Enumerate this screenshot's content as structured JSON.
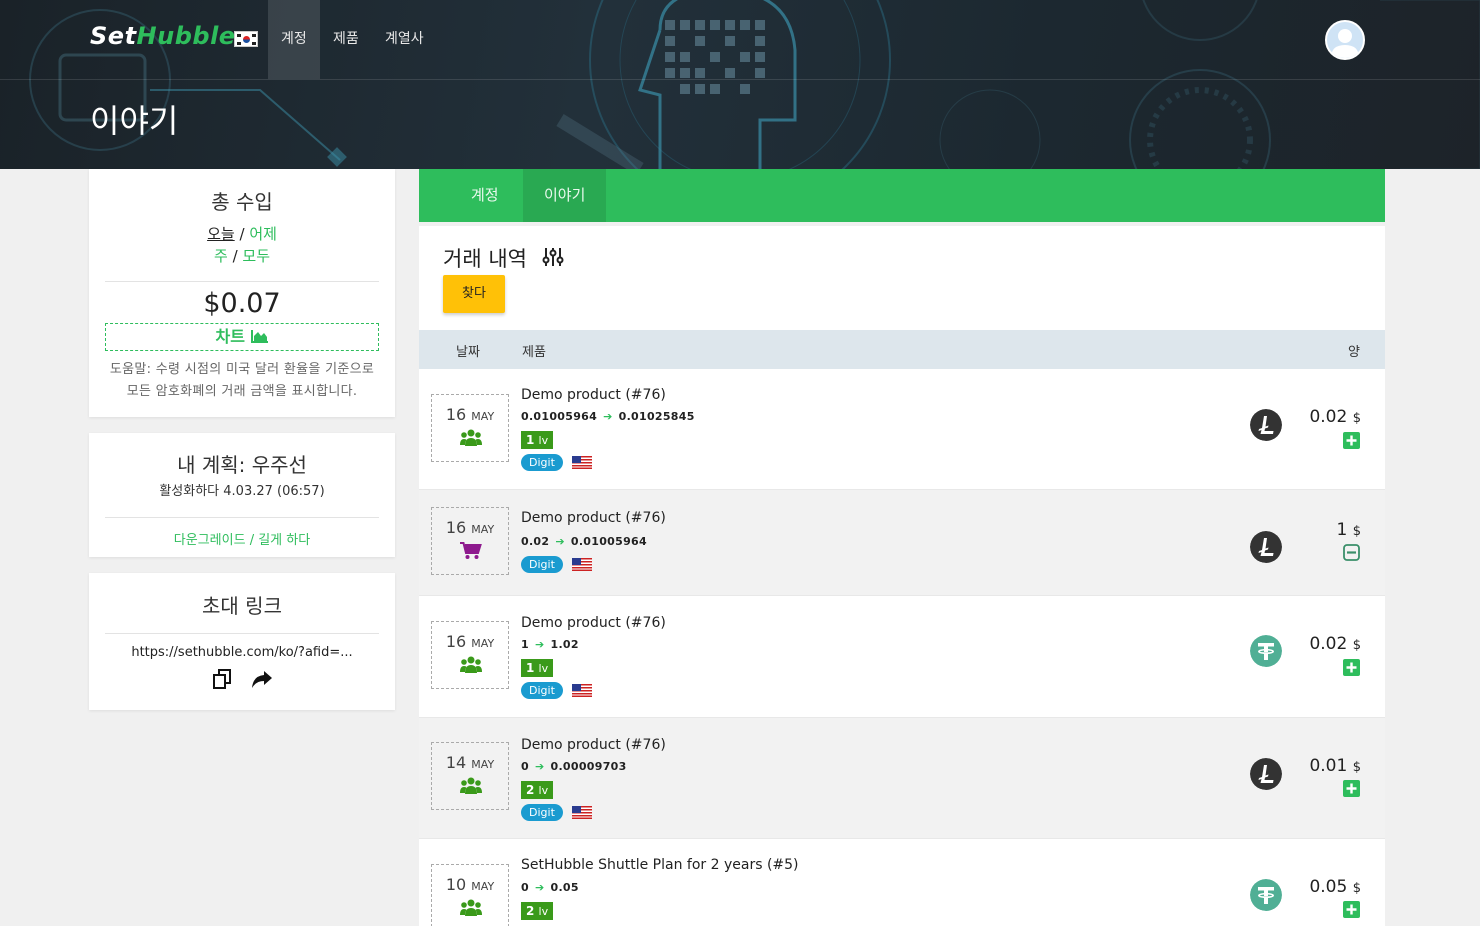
{
  "header": {
    "logo_set": "Set",
    "logo_hubble": "Hubble",
    "nav": [
      {
        "label": "계정"
      },
      {
        "label": "제품"
      },
      {
        "label": "계열사"
      }
    ],
    "page_title": "이야기"
  },
  "earnings": {
    "title": "총 수입",
    "periods": [
      "오늘",
      "어제",
      "주",
      "모두"
    ],
    "separator": "/",
    "amount": "$0.07",
    "chart_label": "차트",
    "help": "도움말: 수령 시점의 미국 달러 환율을 기준으로 모든 암호화폐의 거래 금액을 표시합니다."
  },
  "plan": {
    "title_prefix": "내 계획:",
    "title_name": "우주선",
    "activated": "활성화하다 4.03.27 (06:57)",
    "downgrade": "다운그레이드 / 길게 하다"
  },
  "invite": {
    "title": "초대 링크",
    "url": "https://sethubble.com/ko/?afid=..."
  },
  "tabs": [
    {
      "label": "계정"
    },
    {
      "label": "이야기"
    }
  ],
  "history": {
    "title": "거래 내역",
    "find_button": "찾다",
    "columns": {
      "date": "날짜",
      "product": "제품",
      "amount": "양"
    },
    "rows": [
      {
        "day": "16",
        "month": "MAY",
        "icon": "users-icon",
        "product": "Demo product (#76)",
        "from": "0.01005964",
        "to": "0.01025845",
        "level": "1",
        "level_unit": "lv",
        "tag": "Digit",
        "coin": "litecoin",
        "amount": "0.02",
        "currency": "$",
        "sign": "plus"
      },
      {
        "day": "16",
        "month": "MAY",
        "icon": "cart-icon",
        "product": "Demo product (#76)",
        "from": "0.02",
        "to": "0.01005964",
        "level": "",
        "level_unit": "",
        "tag": "Digit",
        "coin": "litecoin",
        "amount": "1",
        "currency": "$",
        "sign": "minus"
      },
      {
        "day": "16",
        "month": "MAY",
        "icon": "users-icon",
        "product": "Demo product (#76)",
        "from": "1",
        "to": "1.02",
        "level": "1",
        "level_unit": "lv",
        "tag": "Digit",
        "coin": "tether",
        "amount": "0.02",
        "currency": "$",
        "sign": "plus"
      },
      {
        "day": "14",
        "month": "MAY",
        "icon": "users-icon",
        "product": "Demo product (#76)",
        "from": "0",
        "to": "0.00009703",
        "level": "2",
        "level_unit": "lv",
        "tag": "Digit",
        "coin": "litecoin",
        "amount": "0.01",
        "currency": "$",
        "sign": "plus"
      },
      {
        "day": "10",
        "month": "MAY",
        "icon": "users-icon",
        "product": "SetHubble Shuttle Plan for 2 years (#5)",
        "from": "0",
        "to": "0.05",
        "level": "2",
        "level_unit": "lv",
        "tag": "",
        "coin": "tether",
        "amount": "0.05",
        "currency": "$",
        "sign": "plus"
      }
    ]
  },
  "colors": {
    "accent": "#2ebd5c",
    "find_button": "#ffc107",
    "level_badge": "#3a9a1a",
    "digit_badge": "#1a9bd0",
    "litecoin": "#333333",
    "tether": "#50af95",
    "cart": "#8e1a8e"
  }
}
